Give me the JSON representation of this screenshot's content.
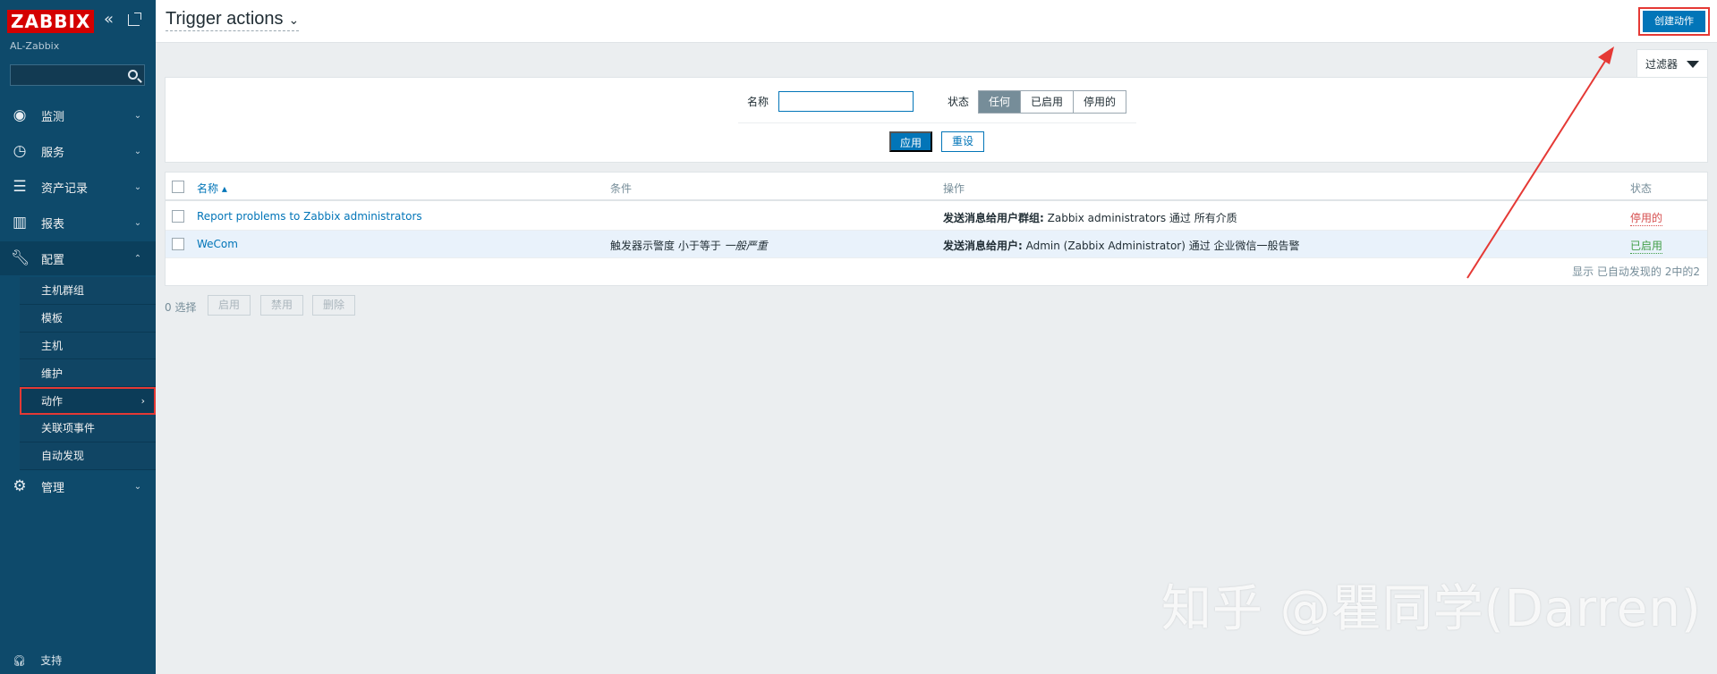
{
  "sidebar": {
    "logo": "ZABBIX",
    "collapse_icon": "«",
    "server_name": "AL-Zabbix",
    "search_placeholder": "",
    "menu": [
      {
        "label": "监测",
        "icon": "eye-icon",
        "chev": "⌄"
      },
      {
        "label": "服务",
        "icon": "clock-icon",
        "chev": "⌄"
      },
      {
        "label": "资产记录",
        "icon": "list-icon",
        "chev": "⌄"
      },
      {
        "label": "报表",
        "icon": "bar-chart-icon",
        "chev": "⌄"
      },
      {
        "label": "配置",
        "icon": "wrench-icon",
        "chev": "⌃"
      }
    ],
    "submenu": [
      {
        "label": "主机群组"
      },
      {
        "label": "模板"
      },
      {
        "label": "主机"
      },
      {
        "label": "维护"
      },
      {
        "label": "动作",
        "chev": "›"
      },
      {
        "label": "关联项事件"
      },
      {
        "label": "自动发现"
      }
    ],
    "admin": {
      "label": "管理",
      "icon": "gear-icon",
      "chev": "⌄"
    },
    "support": "支持"
  },
  "header": {
    "title": "Trigger actions",
    "title_chevron": "⌄",
    "create_button": "创建动作"
  },
  "filter": {
    "tab_label": "过滤器",
    "name_label": "名称",
    "name_value": "",
    "status_label": "状态",
    "status_options": [
      "任何",
      "已启用",
      "停用的"
    ],
    "status_selected": "任何",
    "apply": "应用",
    "reset": "重设"
  },
  "table": {
    "headers": {
      "name": "名称 ▴",
      "conditions": "条件",
      "operations": "操作",
      "status": "状态"
    },
    "rows": [
      {
        "name": "Report problems to Zabbix administrators",
        "conditions": "",
        "op_bold": "发送消息给用户群组:",
        "op_text": " Zabbix administrators 通过 所有介质",
        "status": "停用的"
      },
      {
        "name": "WeCom",
        "cond_text": "触发器示警度 小于等于 ",
        "cond_ital": "一般严重",
        "op_bold": "发送消息给用户:",
        "op_text": " Admin (Zabbix Administrator) 通过 企业微信一般告警",
        "status": "已启用"
      }
    ],
    "footer": "显示 已自动发现的 2中的2"
  },
  "mass": {
    "selected": "0 选择",
    "enable": "启用",
    "disable": "禁用",
    "delete": "删除"
  },
  "colors": {
    "sidebar": "#0e4a6b",
    "accent": "#0275b8",
    "annotation": "#e53935"
  },
  "watermark": "知乎 @瞿同学(Darren)"
}
